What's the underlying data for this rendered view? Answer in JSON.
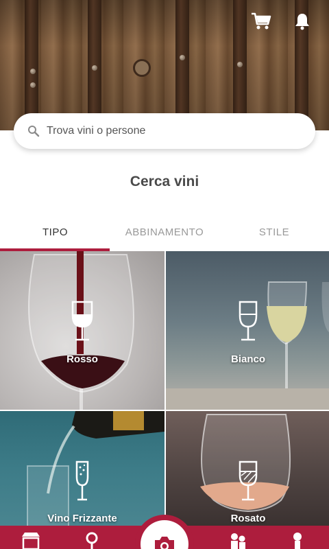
{
  "header": {
    "cart_icon": "shopping-cart-icon",
    "bell_icon": "notification-bell-icon"
  },
  "search": {
    "placeholder": "Trova vini o persone",
    "icon": "search-icon"
  },
  "page_title": "Cerca vini",
  "tabs": [
    {
      "label": "TIPO",
      "active": true
    },
    {
      "label": "ABBINAMENTO",
      "active": false
    },
    {
      "label": "STILE",
      "active": false
    }
  ],
  "tiles": [
    {
      "label": "Rosso",
      "icon": "red-wine-glass-icon"
    },
    {
      "label": "Bianco",
      "icon": "white-wine-glass-icon"
    },
    {
      "label": "Vino Frizzante",
      "icon": "sparkling-wine-glass-icon"
    },
    {
      "label": "Rosato",
      "icon": "rose-wine-glass-icon"
    }
  ],
  "bottom_nav": {
    "items": [
      "store-icon",
      "search-icon",
      "camera-icon",
      "people-icon",
      "profile-icon"
    ]
  },
  "colors": {
    "accent": "#ad1d3d",
    "title": "#4a4a4a",
    "tab_inactive": "#999999"
  }
}
